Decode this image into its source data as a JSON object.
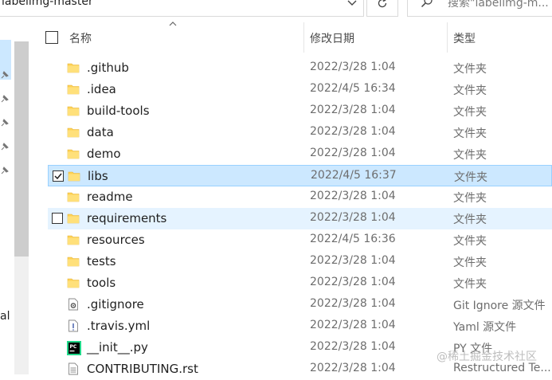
{
  "window": {
    "address_path": "labelimg-master",
    "search_placeholder": "搜索\"labelimg-m..."
  },
  "nav": {
    "partial_label": "al"
  },
  "columns": {
    "name": "名称",
    "date": "修改日期",
    "type": "类型"
  },
  "files": [
    {
      "name": ".github",
      "date": "2022/3/28 1:04",
      "type": "文件夹",
      "icon": "folder-icon"
    },
    {
      "name": ".idea",
      "date": "2022/4/5 16:34",
      "type": "文件夹",
      "icon": "folder-icon"
    },
    {
      "name": "build-tools",
      "date": "2022/3/28 1:04",
      "type": "文件夹",
      "icon": "folder-icon"
    },
    {
      "name": "data",
      "date": "2022/3/28 1:04",
      "type": "文件夹",
      "icon": "folder-icon"
    },
    {
      "name": "demo",
      "date": "2022/3/28 1:04",
      "type": "文件夹",
      "icon": "folder-icon"
    },
    {
      "name": "libs",
      "date": "2022/4/5 16:37",
      "type": "文件夹",
      "icon": "folder-icon",
      "state": "selected"
    },
    {
      "name": "readme",
      "date": "2022/3/28 1:04",
      "type": "文件夹",
      "icon": "folder-icon"
    },
    {
      "name": "requirements",
      "date": "2022/3/28 1:04",
      "type": "文件夹",
      "icon": "folder-icon",
      "state": "hover"
    },
    {
      "name": "resources",
      "date": "2022/4/5 16:36",
      "type": "文件夹",
      "icon": "folder-icon"
    },
    {
      "name": "tests",
      "date": "2022/3/28 1:04",
      "type": "文件夹",
      "icon": "folder-icon"
    },
    {
      "name": "tools",
      "date": "2022/3/28 1:04",
      "type": "文件夹",
      "icon": "folder-icon"
    },
    {
      "name": ".gitignore",
      "date": "2022/3/28 1:04",
      "type": "Git Ignore 源文件",
      "icon": "gear-file-icon"
    },
    {
      "name": ".travis.yml",
      "date": "2022/3/28 1:04",
      "type": "Yaml 源文件",
      "icon": "exclamation-file-icon"
    },
    {
      "name": "__init__.py",
      "date": "2022/3/28 1:04",
      "type": "PY 文件",
      "icon": "pycharm-file-icon"
    },
    {
      "name": "CONTRIBUTING.rst",
      "date": "2022/3/28 1:04",
      "type": "Restructured Te...",
      "icon": "text-file-icon"
    }
  ],
  "watermark": "@稀土掘金技术社区",
  "colors": {
    "selection": "#cce8ff",
    "selection_border": "#99d1ff",
    "hover": "#e5f3ff",
    "folder": "#ffd255"
  }
}
